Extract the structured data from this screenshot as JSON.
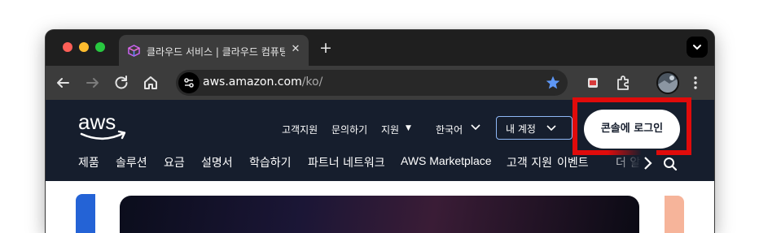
{
  "browser": {
    "tab_title": "클라우드 서비스 | 클라우드 컴퓨팅",
    "url_host": "aws.amazon.com",
    "url_path": "/ko/"
  },
  "aws_header": {
    "logo_text": "aws",
    "util_links": [
      "고객지원",
      "문의하기",
      "지원",
      "한국어"
    ],
    "account_label": "내 계정",
    "console_button": "콘솔에 로그인"
  },
  "main_nav": [
    "제품",
    "솔루션",
    "요금",
    "설명서",
    "학습하기",
    "파트너 네트워크",
    "AWS Marketplace",
    "고객 지원",
    "이벤트",
    "더 알"
  ],
  "colors": {
    "aws_navy": "#161e2d",
    "highlight_red": "#e00b0b",
    "account_border": "#8fb8f7",
    "star_blue": "#5e97f6"
  }
}
